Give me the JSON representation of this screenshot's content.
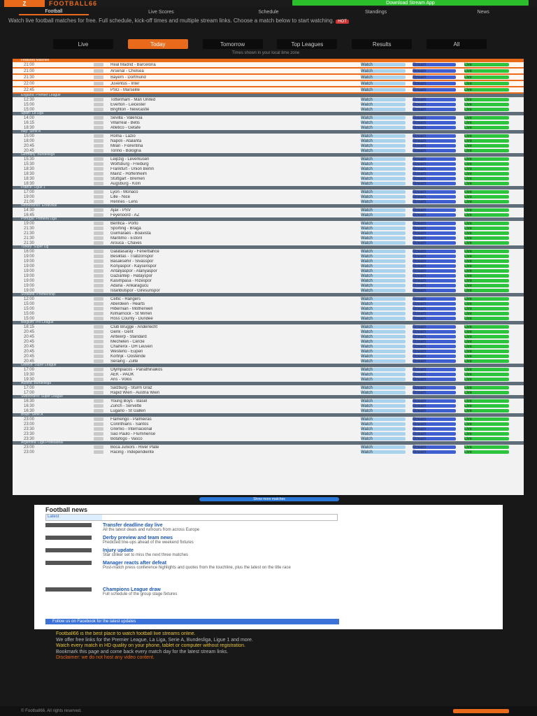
{
  "header": {
    "logo_mark": "Z",
    "logo_text": "FOOTBALL66",
    "cta": "Download Stream App",
    "nav": [
      "Football",
      "Live Scores",
      "Schedule",
      "Standings",
      "News"
    ],
    "active_nav": 0
  },
  "intro": {
    "text": "Watch live football matches for free. Full schedule, kick-off times and multiple stream links. Choose a match below to start watching.",
    "badge": "HOT"
  },
  "filters": {
    "items": [
      "Live",
      "Today",
      "Tomorrow",
      "Top Leagues",
      "Results",
      "All"
    ],
    "active": 1,
    "note": "Times shown in your local time zone"
  },
  "table": {
    "link1": "Watch",
    "link2": "Stream",
    "link3": "Live",
    "featured_group": "Featured Matches",
    "featured": [
      {
        "time": "21:00",
        "match": "Real Madrid - Barcelona"
      },
      {
        "time": "21:00",
        "match": "Arsenal - Chelsea"
      },
      {
        "time": "21:30",
        "match": "Bayern - Dortmund"
      },
      {
        "time": "22:00",
        "match": "Juventus - Inter"
      },
      {
        "time": "22:45",
        "match": "PSG - Marseille"
      }
    ],
    "groups": [
      {
        "name": "England: Premier League",
        "rows": [
          {
            "time": "12:30",
            "match": "Tottenham - Man United"
          },
          {
            "time": "15:00",
            "match": "Everton - Leicester"
          },
          {
            "time": "15:00",
            "match": "Brighton - Newcastle"
          }
        ]
      },
      {
        "name": "Spain: La Liga",
        "rows": [
          {
            "time": "14:00",
            "match": "Sevilla - Valencia"
          },
          {
            "time": "16:15",
            "match": "Villarreal - Betis"
          },
          {
            "time": "18:30",
            "match": "Atletico - Getafe"
          }
        ]
      },
      {
        "name": "Italy: Serie A",
        "rows": [
          {
            "time": "15:00",
            "match": "Roma - Lazio"
          },
          {
            "time": "18:00",
            "match": "Napoli - Atalanta"
          },
          {
            "time": "20:45",
            "match": "Milan - Fiorentina"
          },
          {
            "time": "20:45",
            "match": "Torino - Bologna"
          }
        ]
      },
      {
        "name": "Germany: Bundesliga",
        "rows": [
          {
            "time": "15:30",
            "match": "Leipzig - Leverkusen"
          },
          {
            "time": "15:30",
            "match": "Wolfsburg - Freiburg"
          },
          {
            "time": "18:30",
            "match": "Frankfurt - Union Berlin"
          },
          {
            "time": "18:30",
            "match": "Mainz - Hoffenheim"
          },
          {
            "time": "18:30",
            "match": "Stuttgart - Bremen"
          },
          {
            "time": "18:30",
            "match": "Augsburg - Koln"
          }
        ]
      },
      {
        "name": "France: Ligue 1",
        "rows": [
          {
            "time": "17:00",
            "match": "Lyon - Monaco"
          },
          {
            "time": "19:00",
            "match": "Lille - Nice"
          },
          {
            "time": "21:00",
            "match": "Rennes - Lens"
          }
        ]
      },
      {
        "name": "Netherlands: Eredivisie",
        "rows": [
          {
            "time": "14:30",
            "match": "Ajax - PSV"
          },
          {
            "time": "16:45",
            "match": "Feyenoord - AZ"
          }
        ]
      },
      {
        "name": "Portugal: Primeira Liga",
        "rows": [
          {
            "time": "19:00",
            "match": "Benfica - Porto"
          },
          {
            "time": "21:30",
            "match": "Sporting - Braga"
          },
          {
            "time": "21:30",
            "match": "Guimaraes - Boavista"
          },
          {
            "time": "21:30",
            "match": "Maritimo - Estoril"
          },
          {
            "time": "21:30",
            "match": "Arouca - Chaves"
          }
        ]
      },
      {
        "name": "Turkey: Super Lig",
        "rows": [
          {
            "time": "16:00",
            "match": "Galatasaray - Fenerbahce"
          },
          {
            "time": "19:00",
            "match": "Besiktas - Trabzonspor"
          },
          {
            "time": "19:00",
            "match": "Basaksehir - Sivasspor"
          },
          {
            "time": "19:00",
            "match": "Konyaspor - Kayserispor"
          },
          {
            "time": "19:00",
            "match": "Antalyaspor - Alanyaspor"
          },
          {
            "time": "19:00",
            "match": "Gaziantep - Hatayspor"
          },
          {
            "time": "19:00",
            "match": "Kasimpasa - Rizespor"
          },
          {
            "time": "19:00",
            "match": "Adana - Ankaragucu"
          },
          {
            "time": "19:00",
            "match": "Istanbulspor - Giresunspor"
          }
        ]
      },
      {
        "name": "Scotland: Premiership",
        "rows": [
          {
            "time": "12:00",
            "match": "Celtic - Rangers"
          },
          {
            "time": "15:00",
            "match": "Aberdeen - Hearts"
          },
          {
            "time": "15:00",
            "match": "Hibernian - Motherwell"
          },
          {
            "time": "15:00",
            "match": "Kilmarnock - St Mirren"
          },
          {
            "time": "15:00",
            "match": "Ross County - Dundee"
          }
        ]
      },
      {
        "name": "Belgium: Pro League",
        "rows": [
          {
            "time": "18:15",
            "match": "Club Brugge - Anderlecht"
          },
          {
            "time": "20:45",
            "match": "Genk - Gent"
          },
          {
            "time": "20:45",
            "match": "Antwerp - Standard"
          },
          {
            "time": "20:45",
            "match": "Mechelen - Cercle"
          },
          {
            "time": "20:45",
            "match": "Charleroi - OH Leuven"
          },
          {
            "time": "20:45",
            "match": "Westerlo - Eupen"
          },
          {
            "time": "20:45",
            "match": "Kortrijk - Oostende"
          },
          {
            "time": "20:45",
            "match": "Seraing - Zulte"
          }
        ]
      },
      {
        "name": "Greece: Super League",
        "rows": [
          {
            "time": "17:00",
            "match": "Olympiacos - Panathinaikos"
          },
          {
            "time": "19:30",
            "match": "AEK - PAOK"
          },
          {
            "time": "19:30",
            "match": "Aris - Volos"
          }
        ]
      },
      {
        "name": "Austria: Bundesliga",
        "rows": [
          {
            "time": "17:00",
            "match": "Salzburg - Sturm Graz"
          },
          {
            "time": "17:00",
            "match": "Rapid Wien - Austria Wien"
          }
        ]
      },
      {
        "name": "Switzerland: Super League",
        "rows": [
          {
            "time": "16:30",
            "match": "Young Boys - Basel"
          },
          {
            "time": "16:30",
            "match": "Zurich - Servette"
          },
          {
            "time": "16:30",
            "match": "Lugano - St Gallen"
          }
        ]
      },
      {
        "name": "Brazil: Serie A",
        "rows": [
          {
            "time": "23:00",
            "match": "Flamengo - Palmeiras"
          },
          {
            "time": "23:00",
            "match": "Corinthians - Santos"
          },
          {
            "time": "23:30",
            "match": "Gremio - Internacional"
          },
          {
            "time": "23:30",
            "match": "Sao Paulo - Fluminense"
          },
          {
            "time": "23:30",
            "match": "Botafogo - Vasco"
          }
        ]
      },
      {
        "name": "Argentina: Liga Profesional",
        "rows": [
          {
            "time": "23:00",
            "match": "Boca Juniors - River Plate"
          },
          {
            "time": "23:00",
            "match": "Racing - Independiente"
          }
        ]
      }
    ]
  },
  "more_button": "Show more matches",
  "news": {
    "title": "Football news",
    "search_tab": "Latest",
    "items": [
      {
        "title": "Transfer deadline day live",
        "desc": "All the latest deals and rumours from across Europe"
      },
      {
        "title": "Derby preview and team news",
        "desc": "Predicted line-ups ahead of the weekend fixtures"
      },
      {
        "title": "Injury update",
        "desc": "Star striker set to miss the next three matches"
      },
      {
        "title": "Manager reacts after defeat",
        "desc": "Post-match press conference highlights and quotes from the touchline, plus the latest on the title race"
      },
      {
        "title": "Champions League draw",
        "desc": "Full schedule of the group stage fixtures"
      }
    ],
    "fb_button": "Follow us on Facebook for the latest updates"
  },
  "seo": {
    "text1": "Football66 is the best place to watch football live streams online.",
    "text2": "We offer free links for the Premier League, La Liga, Serie A, Bundesliga, Ligue 1 and more.",
    "text3": "Watch every match in HD quality on your phone, tablet or computer without registration.",
    "text4": "Bookmark this page and come back every match day for the latest stream links.",
    "text5": "Disclaimer: we do not host any video content."
  },
  "footer": {
    "copyright": "© Football66. All rights reserved."
  }
}
